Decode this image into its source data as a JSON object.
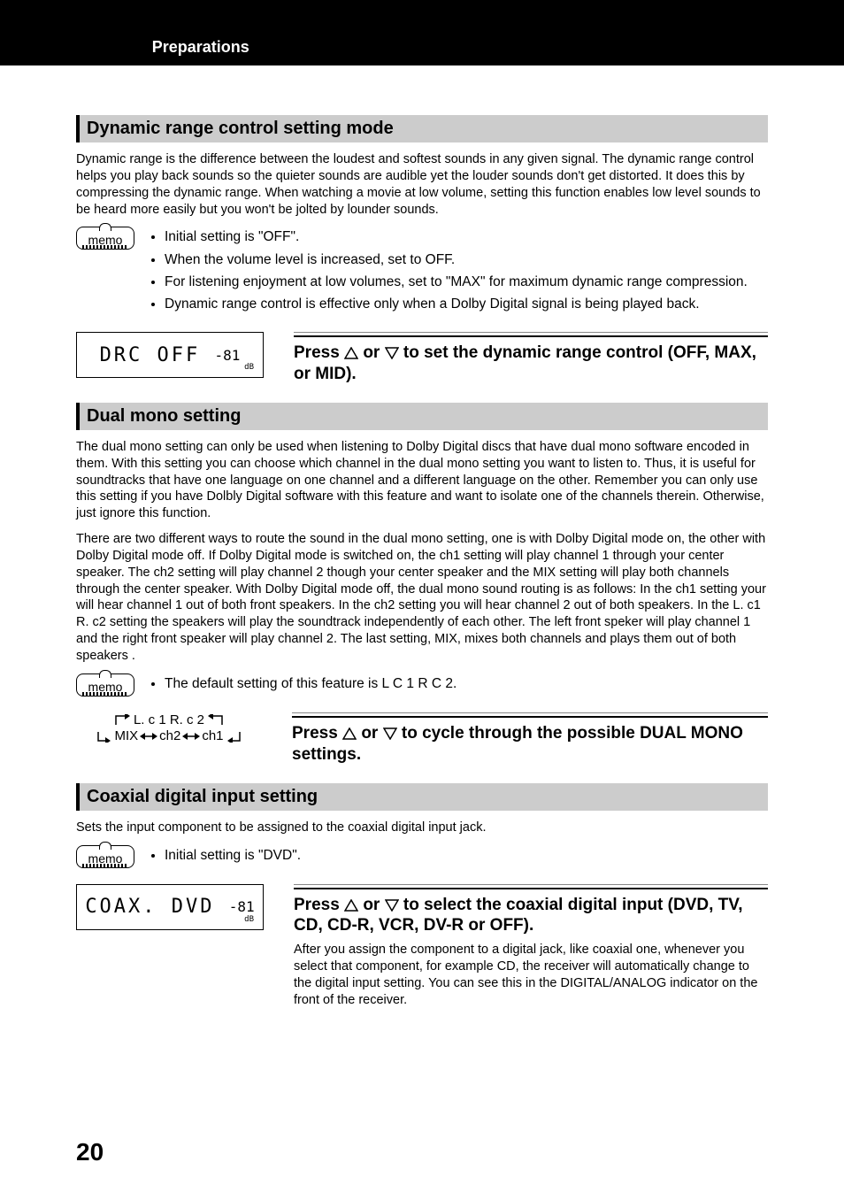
{
  "header": {
    "tab_title": "Preparations"
  },
  "page_number": "20",
  "drc": {
    "heading": "Dynamic range control setting mode",
    "body": "Dynamic range is the difference between the loudest and softest sounds in any given signal. The dynamic range control helps you play back sounds so the quieter sounds are audible yet the louder sounds don't get distorted. It does this by compressing the dynamic range. When watching a movie at low volume, setting this function enables low level sounds to be heard more easily but you won't be jolted by lounder sounds.",
    "memo_label": "memo",
    "memo_items": [
      "Initial setting is \"OFF\".",
      "When the volume level is increased, set to OFF.",
      "For listening enjoyment at low volumes, set to \"MAX\" for maximum dynamic range compression.",
      "Dynamic range control is effective only when a Dolby Digital signal is being played back."
    ],
    "display_main": "DRC  OFF",
    "display_level": "-81",
    "display_db": "dB",
    "instruction_pre": "Press ",
    "instruction_mid": " or ",
    "instruction_post": " to set the dynamic range control (OFF, MAX, or MID)."
  },
  "dual": {
    "heading": "Dual mono setting",
    "body1": "The dual mono setting can only be used when listening to Dolby Digital discs that have dual mono software encoded in them. With this setting you can choose which channel in the dual mono setting you want to listen to. Thus, it is useful for soundtracks that have one language on one channel and a different language on the other. Remember you can only use this setting if you have Dolbly Digital software with this feature and want to isolate one of the channels therein. Otherwise, just ignore this function.",
    "body2": "There are two different ways to route the sound in the dual mono setting, one is with Dolby Digital mode on, the other  with Dolby Digital mode off. If Dolby Digital mode is switched on, the ch1 setting will play channel 1 through your center speaker. The ch2 setting will play channel 2 though your center speaker and the MIX setting will play both channels through the center speaker. With Dolby Digital mode off, the dual mono sound routing is as follows: In the ch1 setting your will hear channel 1 out of both front speakers. In the ch2 setting you will hear channel 2 out of both speakers. In the L. c1 R. c2 setting the speakers will play the soundtrack independently of each other. The left front speker will play channel 1 and the right front speaker will play channel 2. The last setting, MIX, mixes both channels and plays them out of both speakers .",
    "memo_label": "memo",
    "memo_items": [
      "The default setting of this feature is L C 1 R C 2."
    ],
    "cycle": {
      "top": "L. c 1 R. c 2",
      "b1": "MIX",
      "b2": "ch2",
      "b3": "ch1"
    },
    "instruction_pre": "Press ",
    "instruction_mid": " or ",
    "instruction_post": "  to cycle through the possible DUAL MONO settings."
  },
  "coax": {
    "heading": "Coaxial digital input setting",
    "body": "Sets the input component to be assigned to the coaxial digital input jack.",
    "memo_label": "memo",
    "memo_items": [
      "Initial setting is \"DVD\"."
    ],
    "display_main": "COAX.  DVD",
    "display_level": "-81",
    "display_db": "dB",
    "instruction_pre": "Press ",
    "instruction_mid": " or ",
    "instruction_post": " to select the coaxial digital input (DVD, TV, CD, CD-R, VCR, DV-R or OFF).",
    "after": "After you assign the component to a digital jack, like coaxial one, whenever you select that component, for example CD, the receiver will automatically change to the digital input setting. You can see this in the DIGITAL/ANALOG indicator on the front of the receiver."
  }
}
